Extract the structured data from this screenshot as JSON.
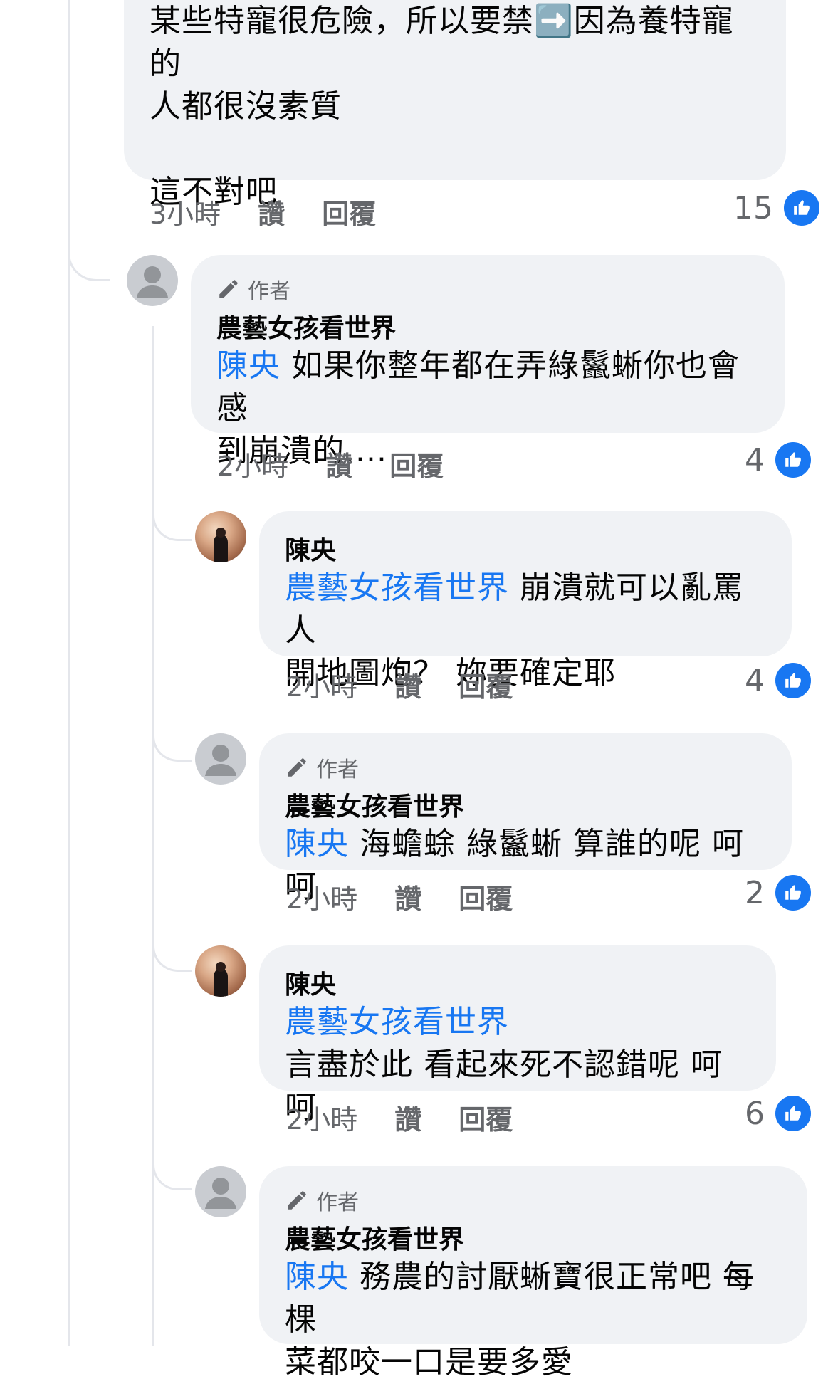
{
  "top_comment": {
    "text_line1": "某些特寵很危險，所以要禁➡️因為養特寵的",
    "text_line2": "人都很沒素質",
    "text_line3": "這不對吧",
    "time": "3小時",
    "like_label": "讚",
    "reply_label": "回覆",
    "likes": "15"
  },
  "replies": [
    {
      "author_badge": "作者",
      "name": "農藝女孩看世界",
      "mention": "陳央",
      "text_line1": " 如果你整年都在弄綠鬣蜥你也會感",
      "text_line2": "到崩潰的....",
      "time": "2小時",
      "like_label": "讚",
      "reply_label": "回覆",
      "likes": "4"
    },
    {
      "name": "陳央",
      "mention": "農藝女孩看世界",
      "text_line1": " 崩潰就可以亂罵人",
      "text_line2": "開地圖炮？ 妳要確定耶",
      "time": "2小時",
      "like_label": "讚",
      "reply_label": "回覆",
      "likes": "4"
    },
    {
      "author_badge": "作者",
      "name": "農藝女孩看世界",
      "mention": "陳央",
      "text_line1": " 海蟾蜍 綠鬣蜥 算誰的呢 呵呵",
      "time": "2小時",
      "like_label": "讚",
      "reply_label": "回覆",
      "likes": "2"
    },
    {
      "name": "陳央",
      "mention": "農藝女孩看世界",
      "text_line2": "言盡於此 看起來死不認錯呢 呵呵",
      "time": "2小時",
      "like_label": "讚",
      "reply_label": "回覆",
      "likes": "6"
    },
    {
      "author_badge": "作者",
      "name": "農藝女孩看世界",
      "mention": "陳央",
      "text_line1": " 務農的討厭蜥寶很正常吧 每棵",
      "text_line2": "菜都咬一口是要多愛"
    }
  ],
  "colors": {
    "accent": "#1877f2",
    "bubble": "#f0f2f5",
    "meta": "#65676b"
  }
}
